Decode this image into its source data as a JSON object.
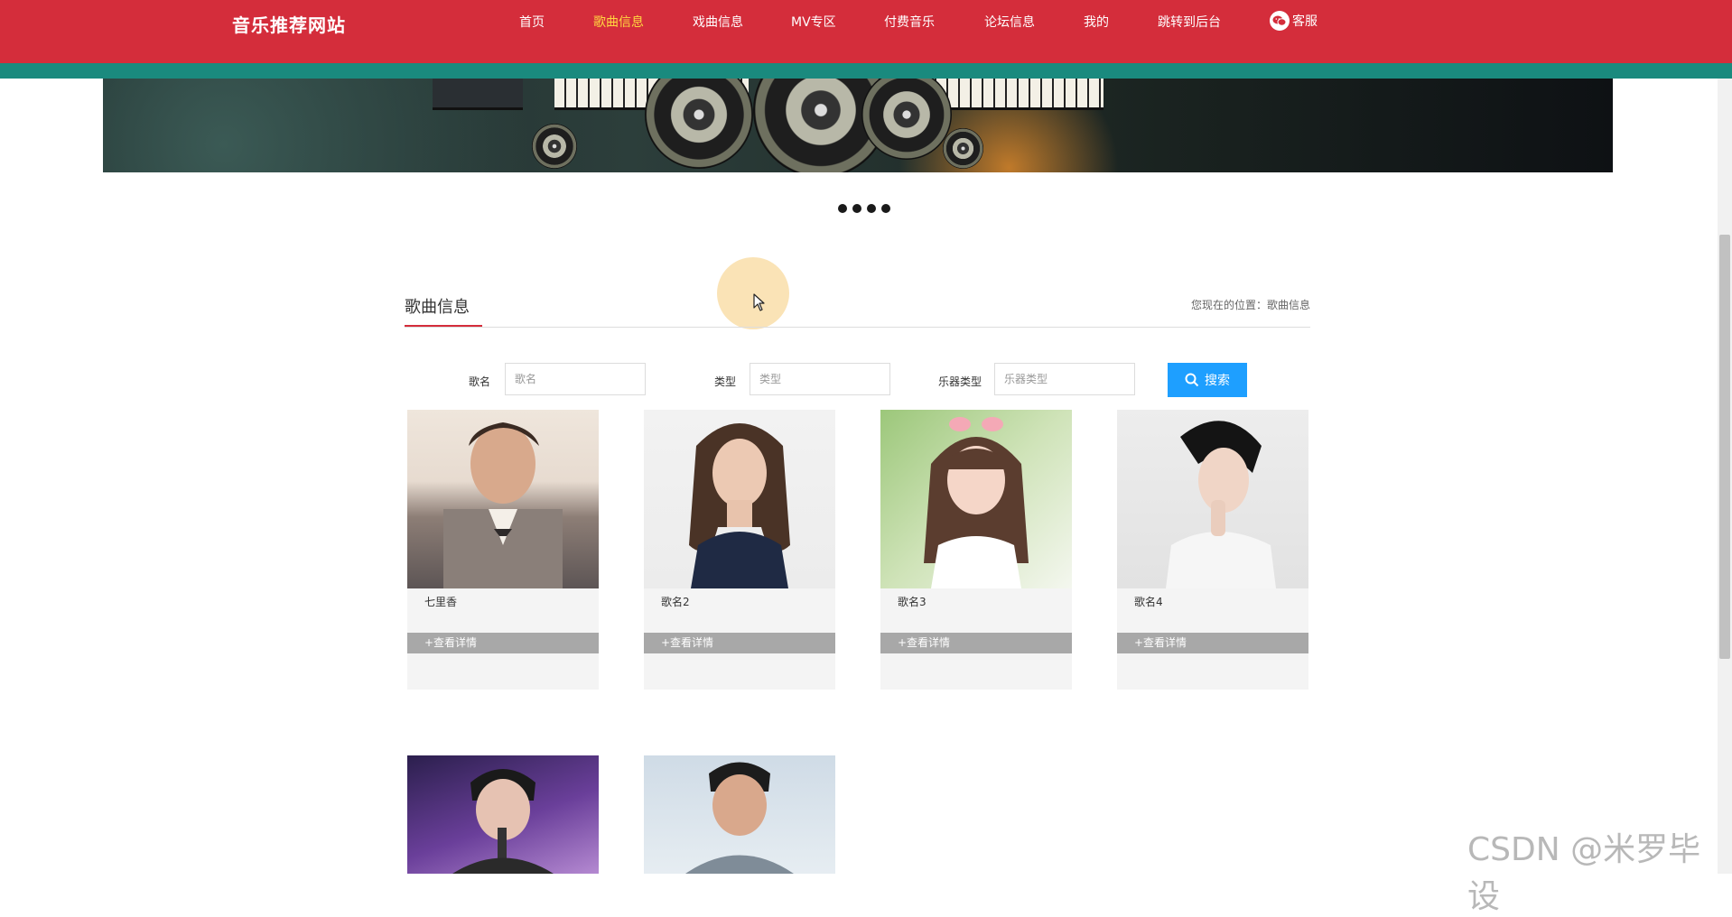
{
  "header": {
    "brand": "音乐推荐网站",
    "nav": [
      {
        "label": "首页",
        "active": false
      },
      {
        "label": "歌曲信息",
        "active": true
      },
      {
        "label": "戏曲信息",
        "active": false
      },
      {
        "label": "MV专区",
        "active": false
      },
      {
        "label": "付费音乐",
        "active": false
      },
      {
        "label": "论坛信息",
        "active": false
      },
      {
        "label": "我的",
        "active": false
      },
      {
        "label": "跳转到后台",
        "active": false
      }
    ],
    "service_label": "客服",
    "accent": "#d42d3b",
    "stripe_color": "#1a8a7e",
    "active_color": "#ffd740"
  },
  "banner": {
    "slide_count": 4
  },
  "section": {
    "title": "歌曲信息",
    "breadcrumb": "您现在的位置：歌曲信息"
  },
  "search": {
    "fields": [
      {
        "label": "歌名",
        "placeholder": "歌名",
        "value": ""
      },
      {
        "label": "类型",
        "placeholder": "类型",
        "value": ""
      },
      {
        "label": "乐器类型",
        "placeholder": "乐器类型",
        "value": ""
      }
    ],
    "button_label": "搜索",
    "button_color": "#1e9fff"
  },
  "songs": [
    {
      "name": "七里香",
      "detail_label": "+查看详情"
    },
    {
      "name": "歌名2",
      "detail_label": "+查看详情"
    },
    {
      "name": "歌名3",
      "detail_label": "+查看详情"
    },
    {
      "name": "歌名4",
      "detail_label": "+查看详情"
    },
    {
      "name": "",
      "detail_label": ""
    },
    {
      "name": "",
      "detail_label": ""
    }
  ],
  "watermark": "CSDN @米罗毕设"
}
